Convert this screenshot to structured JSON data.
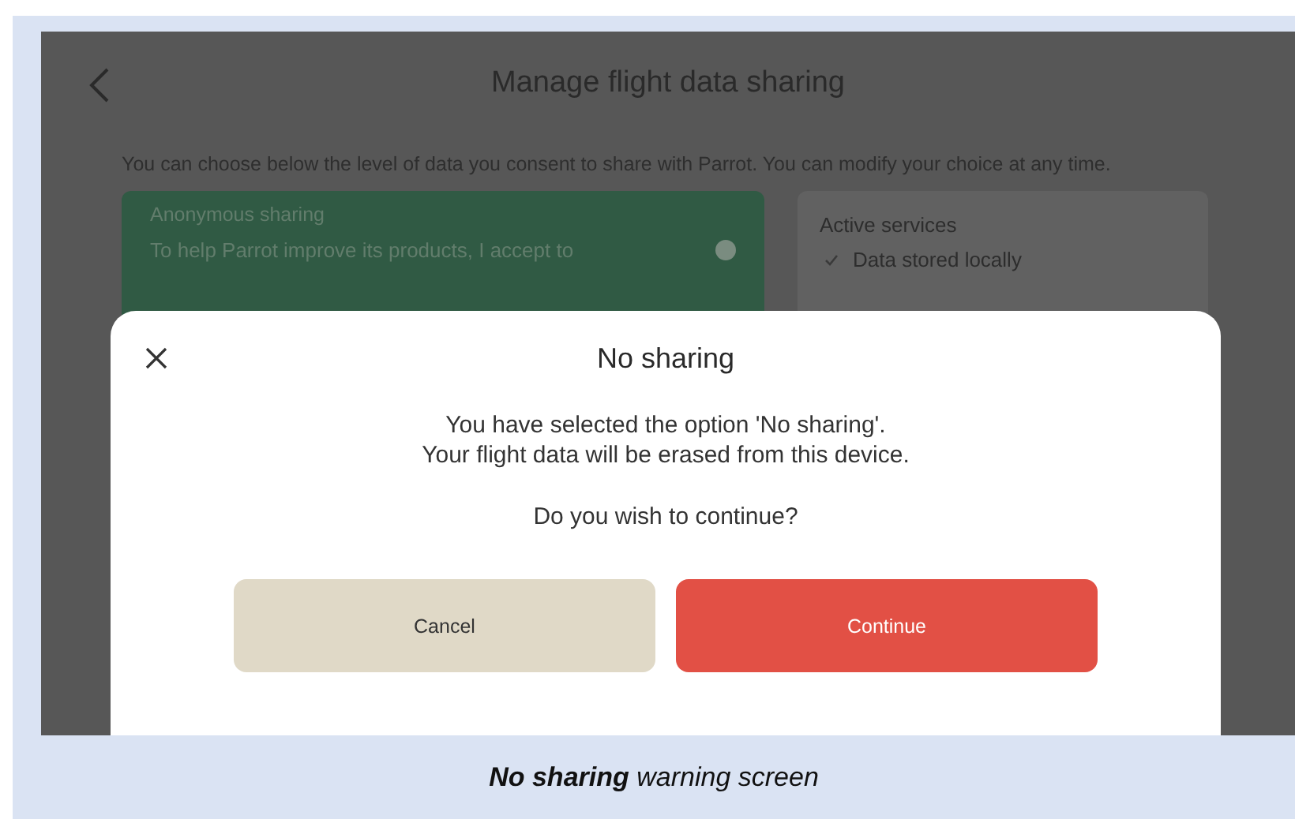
{
  "screen": {
    "title": "Manage flight data sharing",
    "intro": "You can choose below the level of data you consent to share with Parrot. You can modify your choice at any time.",
    "option_card": {
      "title": "Anonymous sharing",
      "text": "To help Parrot improve its products, I accept to"
    },
    "services_card": {
      "title": "Active services",
      "items": [
        "Data stored locally"
      ]
    }
  },
  "dialog": {
    "title": "No sharing",
    "message": [
      "You have selected the option 'No sharing'.",
      "Your flight data will be erased from this device."
    ],
    "question": "Do you wish to continue?",
    "buttons": [
      {
        "label": "Cancel",
        "kind": "secondary"
      },
      {
        "label": "Continue",
        "kind": "primary"
      }
    ]
  },
  "caption": "**No sharing** warning screen"
}
